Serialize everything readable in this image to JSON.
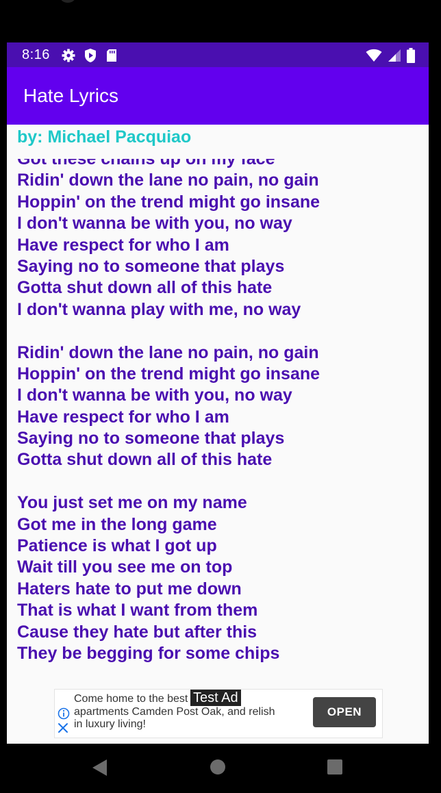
{
  "status_bar": {
    "time": "8:16",
    "left_icons": [
      "gear-icon",
      "play-shield-icon",
      "sd-card-icon"
    ],
    "right_icons": [
      "wifi-icon",
      "cell-signal-icon",
      "battery-icon"
    ]
  },
  "app_bar": {
    "title": "Hate Lyrics"
  },
  "song": {
    "author": "by: Michael Pacquiao",
    "lyrics": [
      "Got these chains up on my face",
      "Ridin' down the lane no pain, no gain",
      "Hoppin' on the trend might go insane",
      "I don't wanna be with you, no way",
      "Have respect for who I am",
      "Saying no to someone that plays",
      "Gotta shut down all of this hate",
      "I don't wanna play with me, no way",
      "",
      "Ridin' down the lane no pain, no gain",
      "Hoppin' on the trend might go insane",
      "I don't wanna be with you, no way",
      "Have respect for who I am",
      "Saying no to someone that plays",
      "Gotta shut down all of this hate",
      "",
      "You just set me on my name",
      "Got me in the long game",
      "Patience is what I got up",
      "Wait till you see me on top",
      "Haters hate to put me down",
      "That is what I want from them",
      "Cause they hate but after this",
      "They be begging for some chips"
    ]
  },
  "ad": {
    "label": "Test Ad",
    "text_lines": [
      "Come home to the best luxury",
      "apartments Camden Post Oak, and relish",
      "in luxury living!"
    ],
    "cta": "OPEN",
    "info_icon": "info-icon",
    "close_icon": "close-icon"
  },
  "nav_bar": {
    "buttons": [
      "back-icon",
      "home-icon",
      "recents-icon"
    ]
  },
  "colors": {
    "status_bar": "#4a0fb0",
    "app_bar": "#6200ee",
    "author": "#1ec8c8",
    "lyrics": "#4a0fb0"
  }
}
